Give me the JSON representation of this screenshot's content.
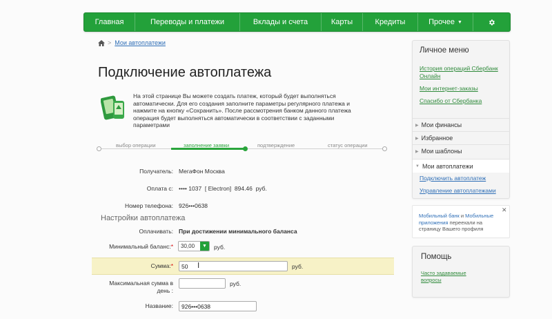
{
  "nav": {
    "items": [
      "Главная",
      "Переводы и платежи",
      "Вклады и счета",
      "Карты",
      "Кредиты",
      "Прочее"
    ],
    "gear_icon": "gear-icon",
    "color": "#23a13a"
  },
  "breadcrumb": {
    "home_icon": "home-icon",
    "link": "Мои автоплатежи"
  },
  "page": {
    "title": "Подключение автоплатежа",
    "intro": "На этой странице Вы можете создать платеж, который будет выполняться автоматически. Для его создания заполните параметры регулярного платежа и нажмите на кнопку «Сохранить». После рассмотрения банком данного платежа операция будет выполняться автоматически в соответствии с заданными параметрами"
  },
  "steps": {
    "items": [
      "выбор операции",
      "заполнение заявки",
      "подтверждение",
      "статус операции"
    ],
    "active": 1
  },
  "form": {
    "recipient_label": "Получатель:",
    "recipient_value": "МегаФон Москва",
    "payfrom_label": "Оплата с:",
    "payfrom_value": "•••• 1037  [ Electron]  894.46  руб.",
    "phone_label": "Номер телефона:",
    "phone_value": "926•••0638",
    "section_title": "Настройки автоплатежа",
    "pay_label": "Оплачивать:",
    "pay_value": "При достижении минимального баланса",
    "minbal_label": "Минимальный баланс:",
    "minbal_value": "30,00",
    "minbal_unit": "руб.",
    "sum_label": "Сумма:",
    "sum_value": "50",
    "sum_unit": "руб.",
    "maxday_label": "Максимальная сумма в день",
    "maxday_label_line1": "Максимальная сумма в",
    "maxday_label_line2": "день :",
    "maxday_value": "",
    "maxday_unit": "руб.",
    "name_label": "Название:",
    "name_value": "926•••0638",
    "required_mark": "*"
  },
  "sidebar": {
    "title": "Личное меню",
    "links": [
      "История операций Сбербанк Онлайн",
      "Мои интернет-заказы",
      "Спасибо от Сбербанка"
    ],
    "sections": [
      "Мои финансы",
      "Избранное",
      "Мои шаблоны",
      "Мои автоплатежи"
    ],
    "sub_links": [
      "Подключить автоплатеж",
      "Управление автоплатежами"
    ],
    "notice_part1": "Мобильный банк",
    "notice_and": " и ",
    "notice_part2": "Мобильные приложения",
    "notice_rest": " переехали на страницу Вашего профиля",
    "help_title": "Помощь",
    "help_link": "Часто задаваемые вопросы"
  }
}
